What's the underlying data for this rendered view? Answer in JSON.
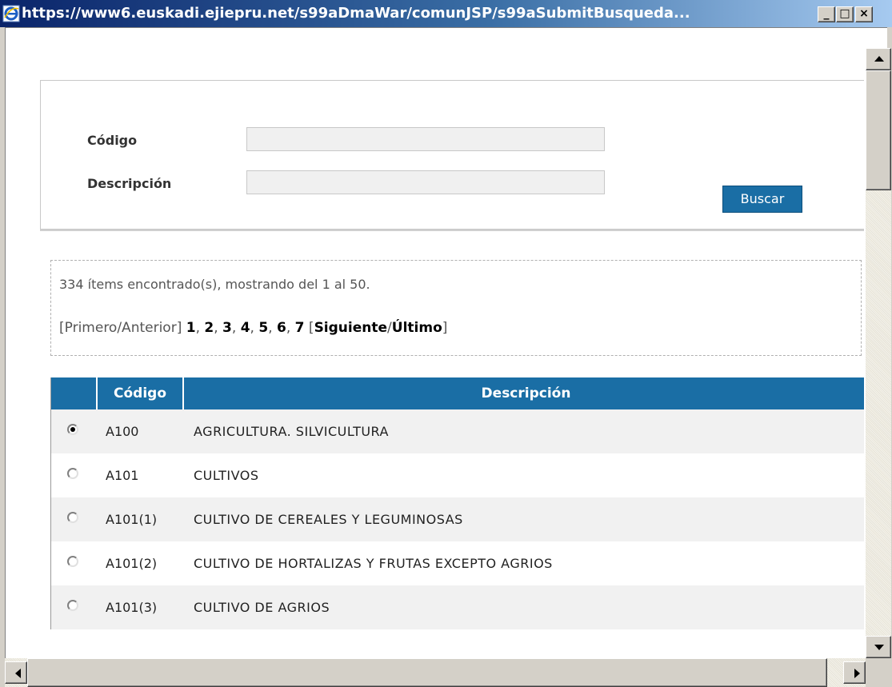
{
  "window": {
    "title": "https://www6.euskadi.ejiepru.net/s99aDmaWar/comunJSP/s99aSubmitBusqueda...",
    "min_label": "_",
    "max_label": "□",
    "close_label": "×"
  },
  "form": {
    "codigo_label": "Código",
    "codigo_value": "",
    "descripcion_label": "Descripción",
    "descripcion_value": "",
    "search_button": "Buscar"
  },
  "results": {
    "count_text": "334 ítems encontrado(s), mostrando del 1 al 50.",
    "nav_first_prev": "[Primero/Anterior]",
    "pages": [
      "1",
      "2",
      "3",
      "4",
      "5",
      "6",
      "7"
    ],
    "next_label": "Siguiente",
    "last_label": "Último"
  },
  "table": {
    "headers": {
      "select": "",
      "codigo": "Código",
      "descripcion": "Descripción"
    },
    "rows": [
      {
        "codigo": "A100",
        "descripcion": "AGRICULTURA. SILVICULTURA",
        "selected": true
      },
      {
        "codigo": "A101",
        "descripcion": "CULTIVOS",
        "selected": false
      },
      {
        "codigo": "A101(1)",
        "descripcion": "CULTIVO DE CEREALES Y LEGUMINOSAS",
        "selected": false
      },
      {
        "codigo": "A101(2)",
        "descripcion": "CULTIVO DE HORTALIZAS Y FRUTAS EXCEPTO AGRIOS",
        "selected": false
      },
      {
        "codigo": "A101(3)",
        "descripcion": "CULTIVO DE AGRIOS",
        "selected": false
      }
    ]
  },
  "colors": {
    "header_blue": "#1a6ea5",
    "title_gradient_start": "#0a246a",
    "title_gradient_end": "#a6caf0"
  }
}
